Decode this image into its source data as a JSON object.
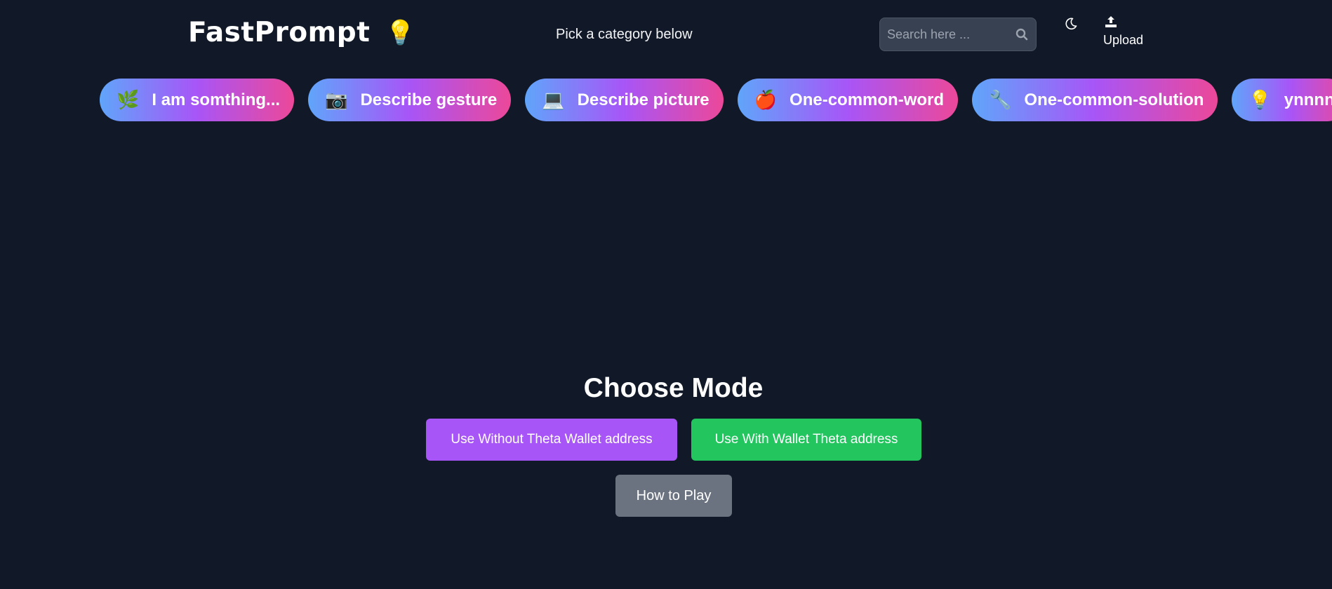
{
  "header": {
    "logo_text": "FastPrompt",
    "logo_emoji": "💡",
    "tagline": "Pick a category below",
    "search": {
      "placeholder": "Search here ...",
      "value": ""
    },
    "upload_label": "Upload"
  },
  "categories": [
    {
      "emoji": "🌿",
      "label": "I am somthing..."
    },
    {
      "emoji": "📷",
      "label": "Describe gesture"
    },
    {
      "emoji": "💻",
      "label": "Describe picture"
    },
    {
      "emoji": "🍎",
      "label": "One-common-word"
    },
    {
      "emoji": "🔧",
      "label": "One-common-solution"
    },
    {
      "emoji": "💡",
      "label": "ynnnn"
    }
  ],
  "mode": {
    "title": "Choose Mode",
    "without_label": "Use Without Theta Wallet address",
    "with_label": "Use With Wallet Theta address",
    "how_to_label": "How to Play"
  },
  "colors": {
    "background": "#111827",
    "purple": "#a855f7",
    "green": "#22c55e",
    "gray": "#6b7280",
    "gradient": [
      "#60a5fa",
      "#a855f7",
      "#ec4899"
    ]
  }
}
